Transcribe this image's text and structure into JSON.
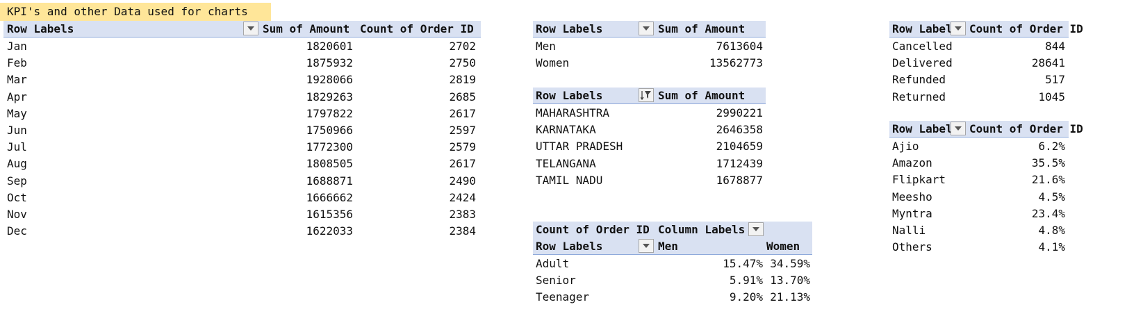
{
  "title": "KPI's and other Data used for charts",
  "monthly": {
    "headers": [
      "Row Labels",
      "Sum of Amount",
      "Count of Order ID"
    ],
    "rows": [
      [
        "Jan",
        "1820601",
        "2702"
      ],
      [
        "Feb",
        "1875932",
        "2750"
      ],
      [
        "Mar",
        "1928066",
        "2819"
      ],
      [
        "Apr",
        "1829263",
        "2685"
      ],
      [
        "May",
        "1797822",
        "2617"
      ],
      [
        "Jun",
        "1750966",
        "2597"
      ],
      [
        "Jul",
        "1772300",
        "2579"
      ],
      [
        "Aug",
        "1808505",
        "2617"
      ],
      [
        "Sep",
        "1688871",
        "2490"
      ],
      [
        "Oct",
        "1666662",
        "2424"
      ],
      [
        "Nov",
        "1615356",
        "2383"
      ],
      [
        "Dec",
        "1622033",
        "2384"
      ]
    ]
  },
  "gender": {
    "headers": [
      "Row Labels",
      "Sum of Amount"
    ],
    "rows": [
      [
        "Men",
        "7613604"
      ],
      [
        "Women",
        "13562773"
      ]
    ]
  },
  "states": {
    "headers": [
      "Row Labels",
      "Sum of Amount"
    ],
    "rows": [
      [
        "MAHARASHTRA",
        "2990221"
      ],
      [
        "KARNATAKA",
        "2646358"
      ],
      [
        "UTTAR PRADESH",
        "2104659"
      ],
      [
        "TELANGANA",
        "1712439"
      ],
      [
        "TAMIL NADU",
        "1678877"
      ]
    ]
  },
  "age": {
    "header1": [
      "Count of Order ID",
      "Column Labels"
    ],
    "header2": [
      "Row Labels",
      "Men",
      "Women"
    ],
    "rows": [
      [
        "Adult",
        "15.47%",
        "34.59%"
      ],
      [
        "Senior",
        "5.91%",
        "13.70%"
      ],
      [
        "Teenager",
        "9.20%",
        "21.13%"
      ]
    ]
  },
  "status": {
    "headers": [
      "Row Label",
      "Count of Order ID"
    ],
    "rows": [
      [
        "Cancelled",
        "844"
      ],
      [
        "Delivered",
        "28641"
      ],
      [
        "Refunded",
        "517"
      ],
      [
        "Returned",
        "1045"
      ]
    ]
  },
  "channel": {
    "headers": [
      "Row Label",
      "Count of Order ID"
    ],
    "rows": [
      [
        "Ajio",
        "6.2%"
      ],
      [
        "Amazon",
        "35.5%"
      ],
      [
        "Flipkart",
        "21.6%"
      ],
      [
        "Meesho",
        "4.5%"
      ],
      [
        "Myntra",
        "23.4%"
      ],
      [
        "Nalli",
        "4.8%"
      ],
      [
        "Others",
        "4.1%"
      ]
    ]
  }
}
